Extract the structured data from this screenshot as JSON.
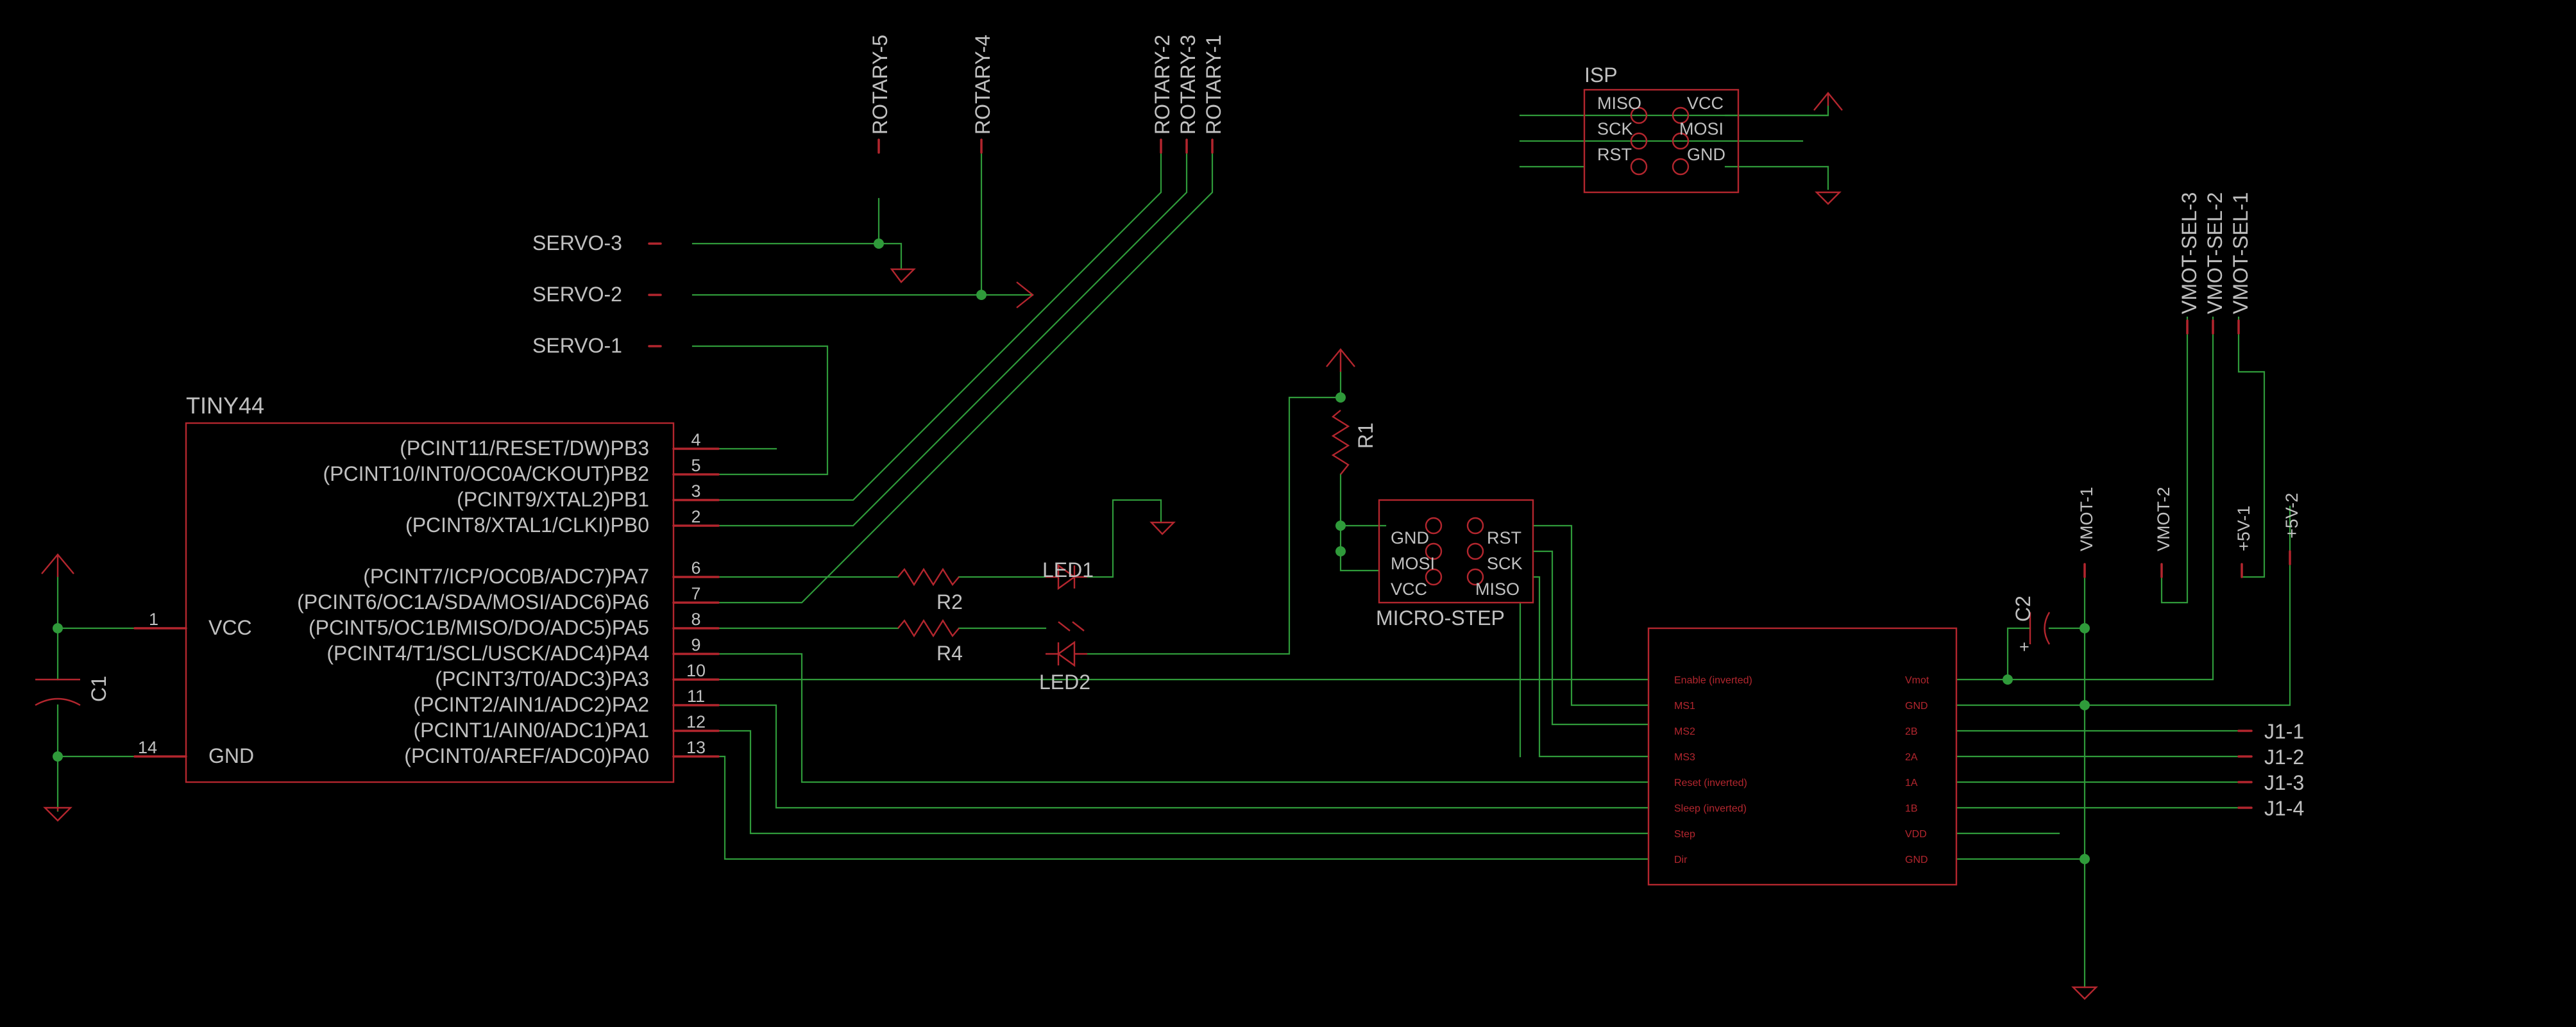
{
  "title": "",
  "colors": {
    "background": "#000000",
    "wire": "#2f9a3a",
    "part": "#b3262e",
    "text": "#c0c0c0"
  },
  "mcu": {
    "name": "TINY44",
    "pins_right": [
      {
        "num": "4",
        "label": "(PCINT11/RESET/DW)PB3"
      },
      {
        "num": "5",
        "label": "(PCINT10/INT0/OC0A/CKOUT)PB2"
      },
      {
        "num": "3",
        "label": "(PCINT9/XTAL2)PB1"
      },
      {
        "num": "2",
        "label": "(PCINT8/XTAL1/CLKI)PB0"
      },
      {
        "num": "6",
        "label": "(PCINT7/ICP/OC0B/ADC7)PA7"
      },
      {
        "num": "7",
        "label": "(PCINT6/OC1A/SDA/MOSI/ADC6)PA6"
      },
      {
        "num": "8",
        "label": "(PCINT5/OC1B/MISO/DO/ADC5)PA5"
      },
      {
        "num": "9",
        "label": "(PCINT4/T1/SCL/USCK/ADC4)PA4"
      },
      {
        "num": "10",
        "label": "(PCINT3/T0/ADC3)PA3"
      },
      {
        "num": "11",
        "label": "(PCINT2/AIN1/ADC2)PA2"
      },
      {
        "num": "12",
        "label": "(PCINT1/AIN0/ADC1)PA1"
      },
      {
        "num": "13",
        "label": "(PCINT0/AREF/ADC0)PA0"
      }
    ],
    "pins_left": [
      {
        "num": "1",
        "label": "VCC"
      },
      {
        "num": "14",
        "label": "GND"
      }
    ]
  },
  "servos": [
    "SERVO-3",
    "SERVO-2",
    "SERVO-1"
  ],
  "rotary": [
    "ROTARY-5",
    "ROTARY-4",
    "ROTARY-2",
    "ROTARY-3",
    "ROTARY-1"
  ],
  "isp": {
    "name": "ISP",
    "pins": [
      "MISO",
      "VCC",
      "SCK",
      "MOSI",
      "RST",
      "GND"
    ]
  },
  "microstep": {
    "name": "MICRO-STEP",
    "pins": [
      "GND",
      "RST",
      "MOSI",
      "SCK",
      "VCC",
      "MISO"
    ]
  },
  "parts": {
    "c1": "C1",
    "c2": "C2",
    "r1": "R1",
    "r2": "R2",
    "r4": "R4",
    "led1": "LED1",
    "led2": "LED2",
    "c2_plus": "+"
  },
  "driver": {
    "left_pins": [
      "Enable (inverted)",
      "MS1",
      "MS2",
      "MS3",
      "Reset (inverted)",
      "Sleep (inverted)",
      "Step",
      "Dir"
    ],
    "right_pins": [
      "Vmot",
      "GND",
      "2B",
      "2A",
      "1A",
      "1B",
      "VDD",
      "GND"
    ]
  },
  "vmot_sel": [
    "VMOT-SEL-3",
    "VMOT-SEL-2",
    "VMOT-SEL-1"
  ],
  "power_pads": [
    "VMOT-1",
    "VMOT-2",
    "+5V-1",
    "+5V-2"
  ],
  "jumpers": [
    "J1-1",
    "J1-2",
    "J1-3",
    "J1-4"
  ]
}
